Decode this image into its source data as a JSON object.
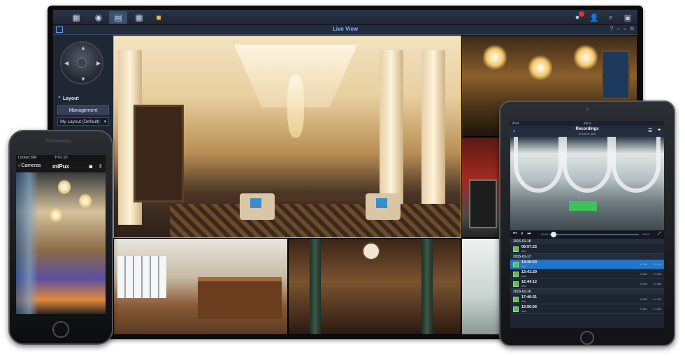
{
  "monitor": {
    "window_title": "Live View",
    "sidebar": {
      "layout_heading": "Layout",
      "management_button": "Management",
      "layout_select": "My Layout (Default)"
    }
  },
  "iphone": {
    "status_carrier": "Locked SIM",
    "status_time": "下午1:22",
    "back_label": "Cameras",
    "camera_title": "miPux"
  },
  "ipad": {
    "status_carrier": "iPad",
    "status_time": "Sat 4",
    "nav_title": "Recordings",
    "nav_subtitle": "Entrance gate",
    "player": {
      "time_start": "00:00",
      "time_end": "-00:13"
    },
    "recordings": [
      {
        "date": "2015-01-18",
        "items": [
          {
            "time": "09:57:22",
            "camera": "Axis",
            "selected": false,
            "res": "",
            "size": ""
          }
        ]
      },
      {
        "date": "2015-01-17",
        "items": [
          {
            "time": "14:20:53",
            "camera": "Axis",
            "selected": true,
            "res": "H.264",
            "size": "1.5 MB"
          },
          {
            "time": "13:41:29",
            "camera": "Axis",
            "selected": false,
            "res": "H.264",
            "size": "1.3 MB"
          },
          {
            "time": "12:44:12",
            "camera": "Axis",
            "selected": false,
            "res": "H.264",
            "size": "1.2 MB"
          }
        ]
      },
      {
        "date": "2015-01-16",
        "items": [
          {
            "time": "17:46:31",
            "camera": "Axis",
            "selected": false,
            "res": "H.264",
            "size": "1.4 MB"
          },
          {
            "time": "13:50:56",
            "camera": "Axis",
            "selected": false,
            "res": "H.264",
            "size": "1.1 MB"
          }
        ]
      }
    ]
  },
  "colors": {
    "accent_blue": "#2177c8",
    "title_blue": "#7fb4ff",
    "recording_green": "#5fbf4a",
    "highlight_gold": "#d7b44a"
  }
}
